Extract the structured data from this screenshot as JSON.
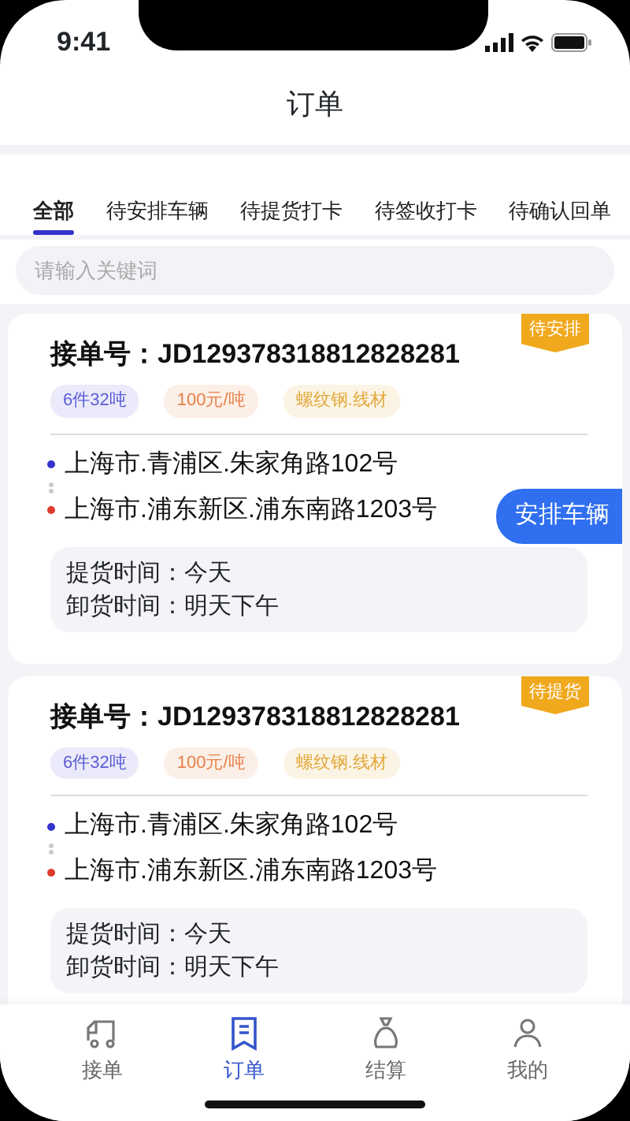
{
  "status_bar": {
    "time": "9:41"
  },
  "page_title": "订单",
  "tabs": [
    {
      "label": "全部",
      "selected": true
    },
    {
      "label": "待安排车辆",
      "selected": false
    },
    {
      "label": "待提货打卡",
      "selected": false
    },
    {
      "label": "待签收打卡",
      "selected": false
    },
    {
      "label": "待确认回单",
      "selected": false
    }
  ],
  "search": {
    "placeholder": "请输入关键词"
  },
  "orders": [
    {
      "status": "待安排",
      "label": "接单号：",
      "number": "JD129378318812828281",
      "tags": [
        {
          "text": "6件32吨",
          "color": "#5b5bd6"
        },
        {
          "text": "100元/吨",
          "color": "#e8814a"
        },
        {
          "text": "螺纹钢.线材",
          "color": "#e2a83a"
        }
      ],
      "from": "上海市.青浦区.朱家角路102号",
      "to": "上海市.浦东新区.浦东南路1203号",
      "times": [
        {
          "label": "提货时间：",
          "value": "今天"
        },
        {
          "label": "卸货时间：",
          "value": "明天下午"
        }
      ],
      "action": "安排车辆"
    },
    {
      "status": "待提货",
      "label": "接单号：",
      "number": "JD129378318812828281",
      "tags": [
        {
          "text": "6件32吨",
          "color": "#5b5bd6"
        },
        {
          "text": "100元/吨",
          "color": "#e8814a"
        },
        {
          "text": "螺纹钢.线材",
          "color": "#e2a83a"
        }
      ],
      "from": "上海市.青浦区.朱家角路102号",
      "to": "上海市.浦东新区.浦东南路1203号",
      "times": [
        {
          "label": "提货时间：",
          "value": "今天"
        },
        {
          "label": "卸货时间：",
          "value": "明天下午"
        }
      ]
    }
  ],
  "bottom_nav": [
    {
      "label": "接单",
      "selected": false
    },
    {
      "label": "订单",
      "selected": true
    },
    {
      "label": "结算",
      "selected": false
    },
    {
      "label": "我的",
      "selected": false
    }
  ]
}
